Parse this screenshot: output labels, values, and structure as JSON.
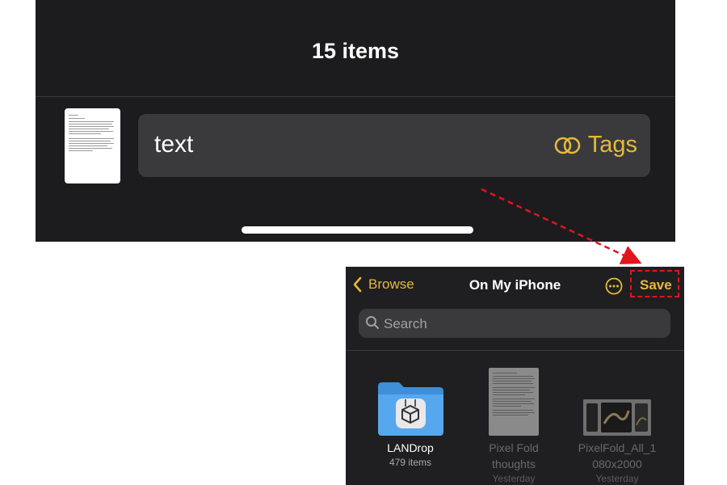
{
  "top_panel": {
    "items_count": "15 items",
    "file_name_value": "text",
    "tags_label": "Tags"
  },
  "files_app": {
    "back_label": "Browse",
    "title": "On My iPhone",
    "more_icon": "ellipsis-circle-icon",
    "save_label": "Save",
    "search_placeholder": "Search",
    "items": [
      {
        "name": "LANDrop",
        "sub": "479 items",
        "kind": "folder"
      },
      {
        "name": "Pixel Fold thoughts",
        "name_line1": "Pixel Fold",
        "name_line2": "thoughts",
        "sub": "Yesterday",
        "kind": "document"
      },
      {
        "name": "PixelFold_All_1080x2000",
        "name_line1": "PixelFold_All_1",
        "name_line2": "080x2000",
        "sub": "Yesterday",
        "kind": "image"
      }
    ]
  },
  "colors": {
    "accent": "#e6b93a",
    "background_dark": "#1c1c1e",
    "annotation_red": "#e3141b"
  }
}
